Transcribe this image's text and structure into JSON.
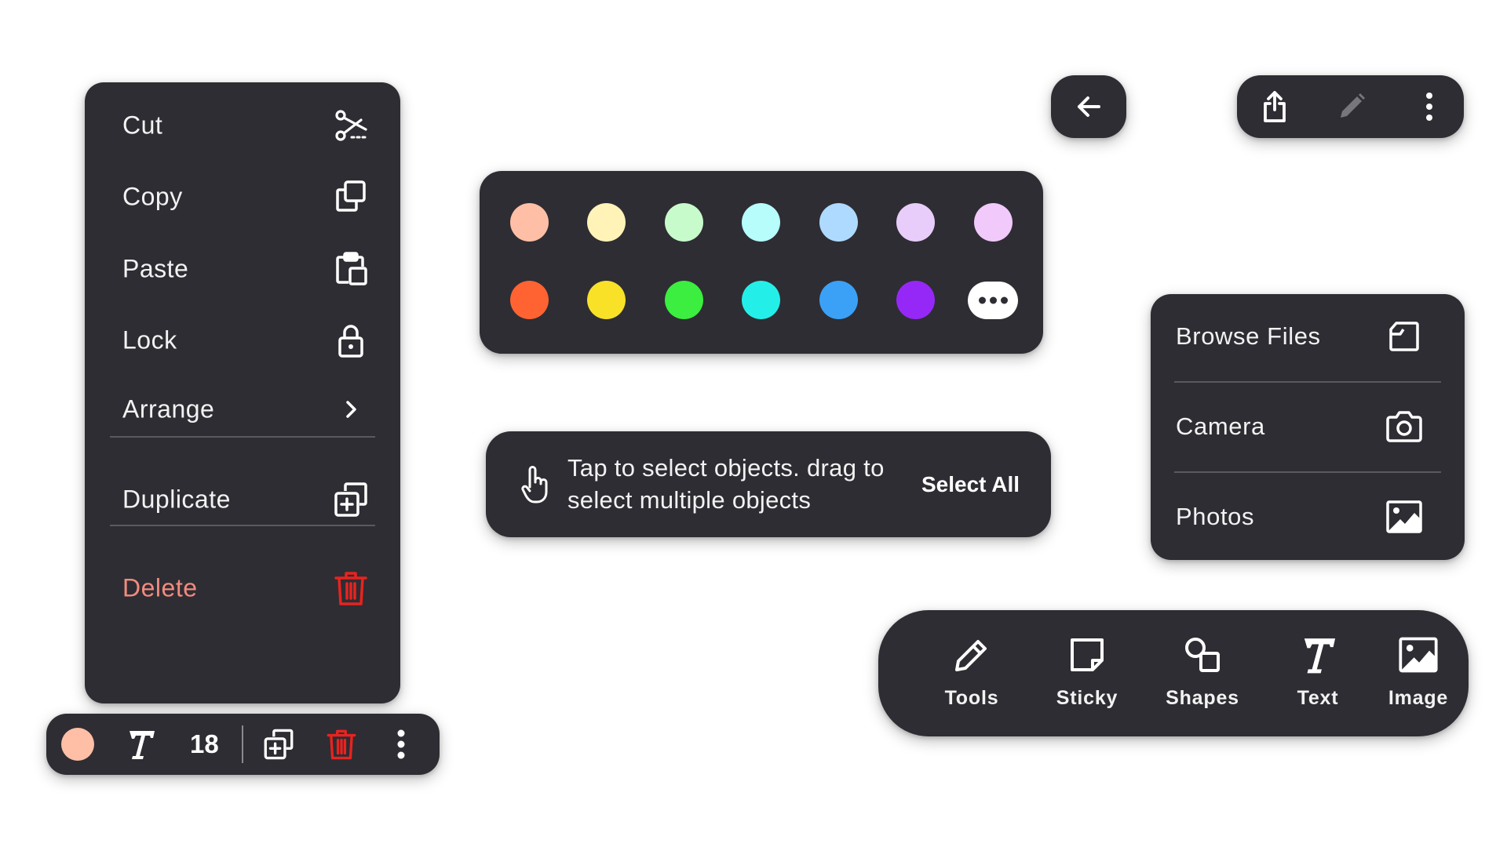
{
  "context_menu": {
    "items": [
      {
        "label": "Cut",
        "icon": "scissors-icon"
      },
      {
        "label": "Copy",
        "icon": "copy-icon"
      },
      {
        "label": "Paste",
        "icon": "paste-icon"
      },
      {
        "label": "Lock",
        "icon": "lock-icon"
      },
      {
        "label": "Arrange",
        "icon": "chevron-right-icon"
      },
      {
        "label": "Duplicate",
        "icon": "duplicate-icon"
      },
      {
        "label": "Delete",
        "icon": "trash-icon"
      }
    ],
    "danger_color": "#f28b7f"
  },
  "text_toolbar": {
    "color_swatch": "#ffbfa6",
    "font_size": "18",
    "icons": [
      "color-swatch",
      "text-style-icon",
      "duplicate-icon",
      "trash-icon",
      "more-vertical-icon"
    ],
    "delete_color": "#e8231f"
  },
  "palette": {
    "light_colors": [
      "#ffbfa6",
      "#fff3b8",
      "#c8fbcb",
      "#b6fdfb",
      "#aedaff",
      "#e8cdfa",
      "#f1c9fa"
    ],
    "strong_colors": [
      "#ff6332",
      "#f9e128",
      "#3bee3f",
      "#23efe8",
      "#3ba1f6",
      "#9628f7"
    ],
    "more_icon": "more-horizontal-icon"
  },
  "snackbar": {
    "message": "Tap to select objects. drag to select multiple objects",
    "action": "Select All",
    "icon": "touch-hand-icon"
  },
  "top_bar": {
    "back_icon": "arrow-back-icon",
    "actions": [
      "share-icon",
      "pencil-icon",
      "more-vertical-icon"
    ]
  },
  "import_menu": {
    "items": [
      {
        "label": "Browse Files",
        "icon": "folder-icon"
      },
      {
        "label": "Camera",
        "icon": "camera-icon"
      },
      {
        "label": "Photos",
        "icon": "image-icon"
      }
    ]
  },
  "tool_bar": {
    "tools": [
      {
        "label": "Tools",
        "icon": "pencil-icon"
      },
      {
        "label": "Sticky",
        "icon": "sticky-note-icon"
      },
      {
        "label": "Shapes",
        "icon": "shapes-icon"
      },
      {
        "label": "Text",
        "icon": "text-icon"
      },
      {
        "label": "Image",
        "icon": "image-icon"
      }
    ]
  }
}
